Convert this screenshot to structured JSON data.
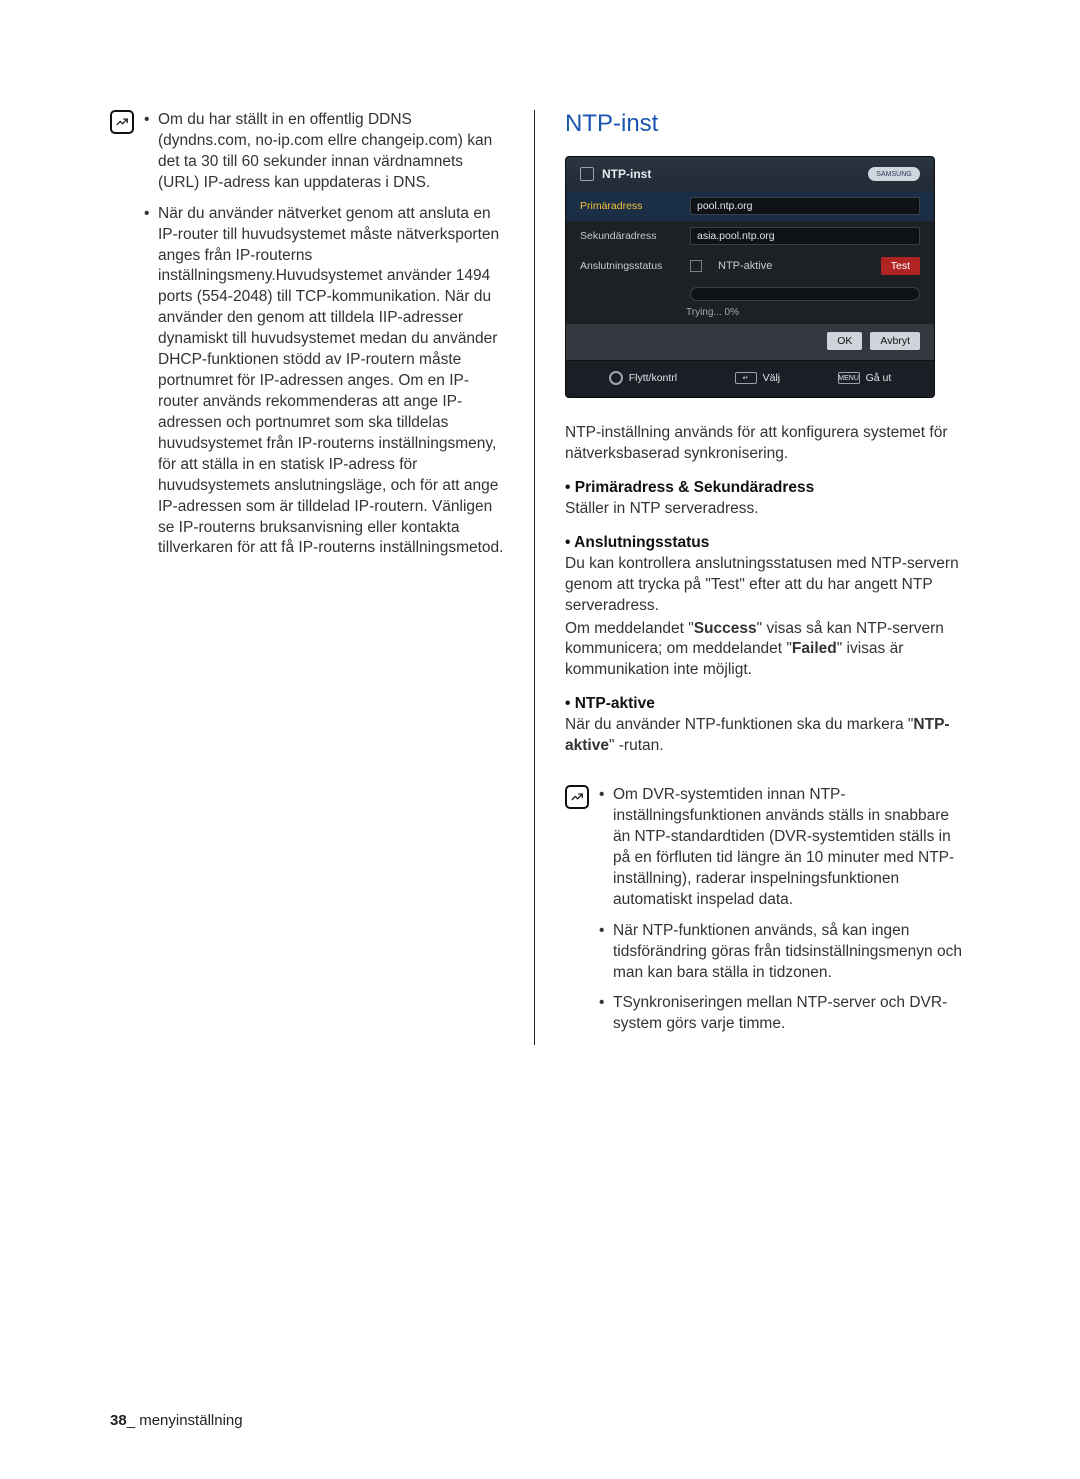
{
  "page": {
    "number": "38",
    "section": "menyinställning"
  },
  "left": {
    "note1": "Om du har ställt in en offentlig DDNS (dyndns.com, no-ip.com ellre changeip.com) kan det ta 30 till 60 sekunder innan värdnamnets (URL) IP-adress kan uppdateras i DNS.",
    "note2": "När du använder nätverket genom att ansluta en IP-router till huvudsystemet måste nätverksporten anges från IP-routerns inställningsmeny.Huvudsystemet använder 1494 ports (554-2048) till TCP-kommunikation. När du använder den genom att tilldela IIP-adresser dynamiskt till huvudsystemet medan du använder DHCP-funktionen stödd av IP-routern måste portnumret för IP-adressen anges. Om en IP-router används rekommenderas att ange IP-adressen och portnumret som ska tilldelas huvudsystemet från IP-routerns inställningsmeny, för att ställa in en statisk IP-adress för huvudsystemets anslutningsläge, och för att ange IP-adressen som är tilldelad IP-routern. Vänligen se IP-routerns bruksanvisning eller kontakta tillverkaren för att få IP-routerns inställningsmetod."
  },
  "right": {
    "heading": "NTP-inst",
    "intro": "NTP-inställning används för att konfigurera systemet för nätverksbaserad synkronisering.",
    "s1_head": "Primäradress & Sekundäradress",
    "s1_body": "Ställer in NTP serveradress.",
    "s2_head": "Anslutningsstatus",
    "s2_body_a": "Du kan kontrollera anslutningsstatusen med NTP-servern genom att trycka på \"Test\" efter att du har angett NTP serveradress.",
    "s2_body_b_pre": "Om meddelandet  \"",
    "s2_body_b_success": "Success",
    "s2_body_b_mid": "\" visas så kan NTP-servern kommunicera; om meddelandet \"",
    "s2_body_b_failed": "Failed",
    "s2_body_b_post": "\" ivisas är kommunikation inte möjligt.",
    "s3_head": "NTP-aktive",
    "s3_body_pre": "När du använder NTP-funktionen ska du markera \"",
    "s3_body_bold": "NTP-aktive",
    "s3_body_post": "\" -rutan.",
    "note1": "Om DVR-systemtiden innan NTP-inställningsfunktionen används ställs in snabbare än NTP-standardtiden (DVR-systemtiden ställs in på en förfluten tid längre än 10 minuter med NTP-inställning), raderar inspelningsfunktionen automatiskt inspelad data.",
    "note2": "När NTP-funktionen används, så kan ingen tidsförändring göras från tidsinställningsmenyn och man kan bara ställa in tidzonen.",
    "note3": "TSynkroniseringen mellan NTP-server och DVR-system görs varje timme."
  },
  "osd": {
    "title": "NTP-inst",
    "brand": "SAMSUNG",
    "row1_label": "Primäradress",
    "row1_value": "pool.ntp.org",
    "row2_label": "Sekundäradress",
    "row2_value": "asia.pool.ntp.org",
    "row3_label": "Anslutningsstatus",
    "row3_chk": "NTP-aktive",
    "row3_btn": "Test",
    "status": "Trying... 0%",
    "ok": "OK",
    "cancel": "Avbryt",
    "f1": "Flytt/kontrl",
    "f2": "Välj",
    "f2_key": "↵",
    "f3": "Gå ut",
    "f3_key": "MENU"
  }
}
